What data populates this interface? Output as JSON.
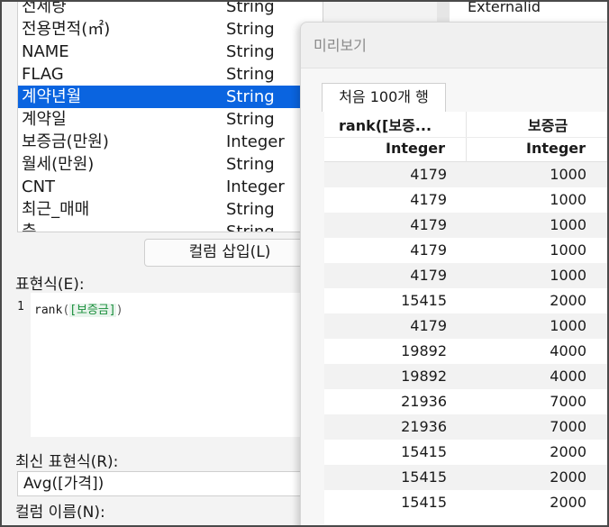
{
  "columns": [
    {
      "name": "전세량",
      "type": "String"
    },
    {
      "name": "전용면적(㎡)",
      "type": "String"
    },
    {
      "name": "NAME",
      "type": "String"
    },
    {
      "name": "FLAG",
      "type": "String"
    },
    {
      "name": "계약년월",
      "type": "String",
      "selected": true
    },
    {
      "name": "계약일",
      "type": "String"
    },
    {
      "name": "보증금(만원)",
      "type": "Integer"
    },
    {
      "name": "월세(만원)",
      "type": "String"
    },
    {
      "name": "CNT",
      "type": "Integer"
    },
    {
      "name": "최근_매매",
      "type": "String"
    },
    {
      "name": "층",
      "type": "String"
    }
  ],
  "insert_button": "컬럼 삽입(L)",
  "expression": {
    "label": "표현식(E):",
    "line_number": "1",
    "fn": "rank",
    "open": "(",
    "ref": "[보증금]",
    "close": ")"
  },
  "recent": {
    "label": "최신 표현식(R):",
    "value": "Avg([가격])"
  },
  "column_name_label": "컬럼 이름(N):",
  "background": {
    "external_label": "Externalid"
  },
  "preview": {
    "title": "미리보기",
    "tab": "처음 100개 행",
    "headers": [
      {
        "name": "rank([보증...",
        "type": "Integer"
      },
      {
        "name": "보증금",
        "type": "Integer"
      }
    ],
    "rows": [
      [
        "4179",
        "1000"
      ],
      [
        "4179",
        "1000"
      ],
      [
        "4179",
        "1000"
      ],
      [
        "4179",
        "1000"
      ],
      [
        "4179",
        "1000"
      ],
      [
        "15415",
        "2000"
      ],
      [
        "4179",
        "1000"
      ],
      [
        "19892",
        "4000"
      ],
      [
        "19892",
        "4000"
      ],
      [
        "21936",
        "7000"
      ],
      [
        "21936",
        "7000"
      ],
      [
        "15415",
        "2000"
      ],
      [
        "15415",
        "2000"
      ],
      [
        "15415",
        "2000"
      ]
    ]
  },
  "colors": {
    "selection": "#0a64e0",
    "ref_text": "#1a8f3c"
  }
}
